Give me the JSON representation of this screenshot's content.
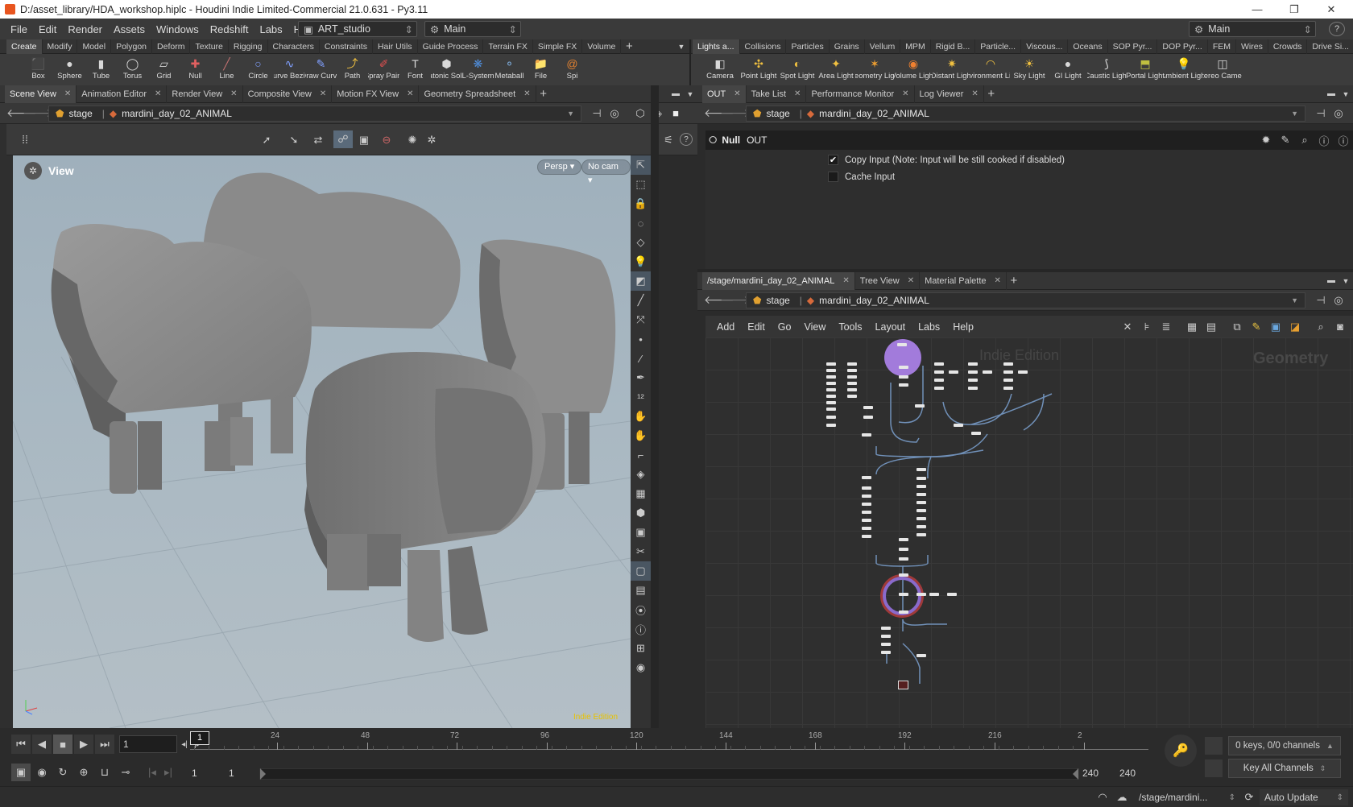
{
  "window": {
    "title": "D:/asset_library/HDA_workshop.hiplc - Houdini Indie Limited-Commercial 21.0.631 - Py3.11",
    "controls": [
      "—",
      "❐",
      "✕"
    ]
  },
  "menubar": {
    "items": [
      "File",
      "Edit",
      "Render",
      "Assets",
      "Windows",
      "Redshift",
      "Labs",
      "Help"
    ],
    "desktop": "ART_studio",
    "main_label": "Main",
    "right_main": "Main"
  },
  "shelf_left": {
    "tabs": [
      "Create",
      "Modify",
      "Model",
      "Polygon",
      "Deform",
      "Texture",
      "Rigging",
      "Characters",
      "Constraints",
      "Hair Utils",
      "Guide Process",
      "Terrain FX",
      "Simple FX",
      "Volume"
    ],
    "tools": [
      {
        "label": "Box",
        "icon": "box-icon"
      },
      {
        "label": "Sphere",
        "icon": "sphere-icon"
      },
      {
        "label": "Tube",
        "icon": "tube-icon"
      },
      {
        "label": "Torus",
        "icon": "torus-icon"
      },
      {
        "label": "Grid",
        "icon": "grid-icon"
      },
      {
        "label": "Null",
        "icon": "null-icon"
      },
      {
        "label": "Line",
        "icon": "line-icon"
      },
      {
        "label": "Circle",
        "icon": "circle-icon"
      },
      {
        "label": "Curve Bezier",
        "icon": "curve-bezier-icon"
      },
      {
        "label": "Draw Curve",
        "icon": "draw-curve-icon"
      },
      {
        "label": "Path",
        "icon": "path-icon"
      },
      {
        "label": "Spray Paint",
        "icon": "spray-paint-icon"
      },
      {
        "label": "Font",
        "icon": "font-icon"
      },
      {
        "label": "Platonic Solids",
        "icon": "platonic-icon"
      },
      {
        "label": "L-System",
        "icon": "lsystem-icon"
      },
      {
        "label": "Metaball",
        "icon": "metaball-icon"
      },
      {
        "label": "File",
        "icon": "file-icon"
      },
      {
        "label": "Spi",
        "icon": "spiral-icon"
      }
    ]
  },
  "shelf_right": {
    "tabs": [
      "Lights a...",
      "Collisions",
      "Particles",
      "Grains",
      "Vellum",
      "MPM",
      "Rigid B...",
      "Particle...",
      "Viscous...",
      "Oceans",
      "SOP Pyr...",
      "DOP Pyr...",
      "FEM",
      "Wires",
      "Crowds",
      "Drive Si..."
    ],
    "tools": [
      {
        "label": "Camera",
        "icon": "camera-icon"
      },
      {
        "label": "Point Light",
        "icon": "point-light-icon"
      },
      {
        "label": "Spot Light",
        "icon": "spot-light-icon"
      },
      {
        "label": "Area Light",
        "icon": "area-light-icon"
      },
      {
        "label": "Geometry Light",
        "icon": "geometry-light-icon"
      },
      {
        "label": "Volume Light",
        "icon": "volume-light-icon"
      },
      {
        "label": "Distant Light",
        "icon": "distant-light-icon"
      },
      {
        "label": "Environment Light",
        "icon": "environment-light-icon"
      },
      {
        "label": "Sky Light",
        "icon": "sky-light-icon"
      },
      {
        "label": "GI Light",
        "icon": "gi-light-icon"
      },
      {
        "label": "Caustic Light",
        "icon": "caustic-light-icon"
      },
      {
        "label": "Portal Light",
        "icon": "portal-light-icon"
      },
      {
        "label": "Ambient Light",
        "icon": "ambient-light-icon"
      },
      {
        "label": "Stereo Camera",
        "icon": "stereo-camera-icon"
      }
    ]
  },
  "left_pane": {
    "tabs": [
      "Scene View",
      "Animation Editor",
      "Render View",
      "Composite View",
      "Motion FX View",
      "Geometry Spreadsheet"
    ],
    "path_root": "stage",
    "path_node": "mardini_day_02_ANIMAL",
    "viewport_label": "View",
    "persp": "Persp ▾",
    "cam": "No cam ▾",
    "watermark": "Indie Edition"
  },
  "param_pane": {
    "tabs": [
      "OUT",
      "Take List",
      "Performance Monitor",
      "Log Viewer"
    ],
    "path_root": "stage",
    "path_node": "mardini_day_02_ANIMAL",
    "node_type": "Null",
    "node_name": "OUT",
    "params": [
      {
        "label": "Copy Input (Note: Input will be still cooked if disabled)",
        "checked": true
      },
      {
        "label": "Cache Input",
        "checked": false
      }
    ]
  },
  "network_pane": {
    "tabs": [
      "/stage/mardini_day_02_ANIMAL",
      "Tree View",
      "Material Palette"
    ],
    "path_root": "stage",
    "path_node": "mardini_day_02_ANIMAL",
    "menu": [
      "Add",
      "Edit",
      "Go",
      "View",
      "Tools",
      "Layout",
      "Labs",
      "Help"
    ],
    "watermark": "Indie Edition",
    "context_label": "Geometry"
  },
  "timeline": {
    "current_frame": "1",
    "ticks": [
      "1",
      "24",
      "48",
      "72",
      "96",
      "120",
      "144",
      "168",
      "192",
      "216",
      "2"
    ],
    "range_start": "1",
    "range_start2": "1",
    "range_end": "240",
    "range_end2": "240",
    "keys_label": "0 keys, 0/0 channels",
    "key_all": "Key All Channels"
  },
  "statusbar": {
    "path": "/stage/mardini...",
    "update_mode": "Auto Update"
  }
}
